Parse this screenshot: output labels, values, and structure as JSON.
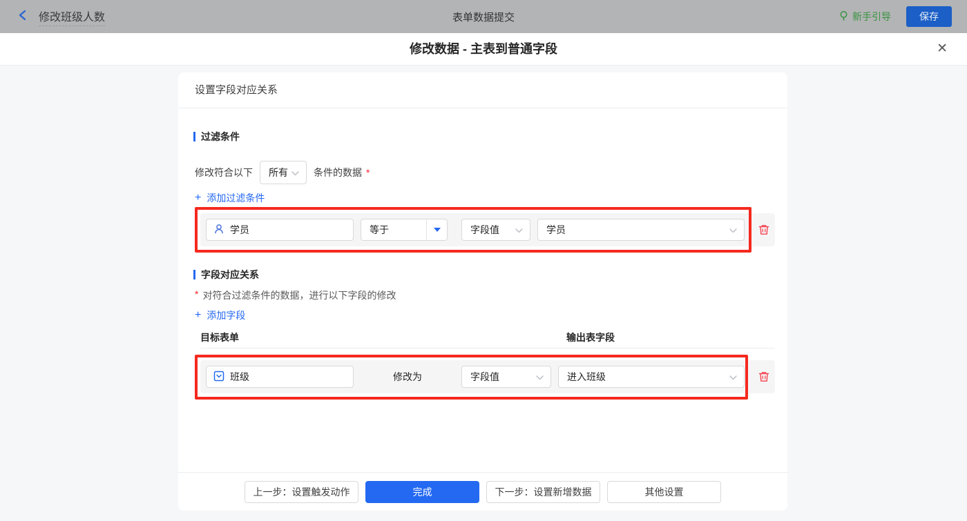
{
  "topbar": {
    "back_title": "修改班级人数",
    "center_title": "表单数据提交",
    "guide_label": "新手引导",
    "save_label": "保存"
  },
  "modal": {
    "title": "修改数据 - 主表到普通字段",
    "close_icon": "✕"
  },
  "panel": {
    "header": "设置字段对应关系"
  },
  "filter": {
    "title": "过滤条件",
    "cond_prefix": "修改符合以下",
    "match_value": "所有",
    "cond_suffix": "条件的数据",
    "required_mark": "*",
    "add_plus": "+",
    "add_label": "添加过滤条件",
    "row": {
      "field": "学员",
      "operator": "等于",
      "value_type": "字段值",
      "value": "学员"
    }
  },
  "mapping": {
    "title": "字段对应关系",
    "required_mark": "*",
    "description": "对符合过滤条件的数据，进行以下字段的修改",
    "add_plus": "+",
    "add_label": "添加字段",
    "col_target": "目标表单",
    "col_output": "输出表字段",
    "row": {
      "field": "班级",
      "action": "修改为",
      "value_type": "字段值",
      "value": "进入班级"
    }
  },
  "footer": {
    "prev_label": "上一步：设置触发动作",
    "done_label": "完成",
    "next_label": "下一步：设置新增数据",
    "other_label": "其他设置"
  },
  "icons": {
    "back": "chevron-left",
    "guide": "lightbulb-pin",
    "close": "x",
    "member_field": "person",
    "select_field": "checkbox-dropdown",
    "operator_caret": "caret-down-filled",
    "select_arrow": "chevron-down",
    "delete": "trash",
    "add": "plus"
  },
  "colors": {
    "accent_blue": "#2468f2",
    "save_button_blue": "#1b5fc7",
    "guide_green": "#37923f",
    "highlight_red": "#f5291f",
    "delete_red": "#f5434f",
    "required_red": "#f5222d",
    "topbar_gray": "#b3b4b6",
    "row_gray": "#f5f5f6",
    "page_bg": "#f6f7f9"
  }
}
